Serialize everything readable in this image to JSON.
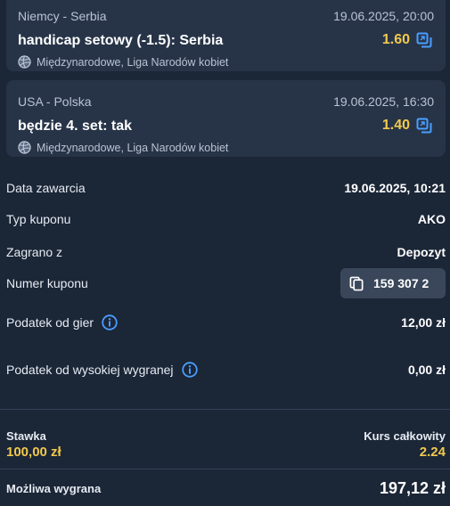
{
  "bets": [
    {
      "teams": "Niemcy - Serbia",
      "date": "19.06.2025, 20:00",
      "selection": "handicap setowy (-1.5): Serbia",
      "odds": "1.60",
      "league": "Międzynarodowe, Liga Narodów kobiet"
    },
    {
      "teams": "USA - Polska",
      "date": "19.06.2025, 16:30",
      "selection": "będzie 4. set: tak",
      "odds": "1.40",
      "league": "Międzynarodowe, Liga Narodów kobiet"
    }
  ],
  "details": {
    "date_label": "Data zawarcia",
    "date_value": "19.06.2025, 10:21",
    "type_label": "Typ kuponu",
    "type_value": "AKO",
    "source_label": "Zagrano z",
    "source_value": "Depozyt",
    "coupon_label": "Numer kuponu",
    "coupon_value": "159 307 2",
    "tax_label": "Podatek od gier",
    "tax_value": "12,00 zł",
    "high_tax_label": "Podatek od wysokiej wygranej",
    "high_tax_value": "0,00 zł"
  },
  "summary": {
    "stake_label": "Stawka",
    "stake_value": "100,00 zł",
    "total_odds_label": "Kurs całkowity",
    "total_odds_value": "2.24",
    "possible_win_label": "Możliwa wygrana",
    "possible_win_value": "197,12 zł"
  },
  "colors": {
    "background": "#1b2637",
    "card": "#273448",
    "accent_odds": "#f2c94c",
    "icon_blue": "#4a9eff"
  },
  "icons": [
    "copy-icon",
    "volleyball-icon",
    "info-icon"
  ]
}
